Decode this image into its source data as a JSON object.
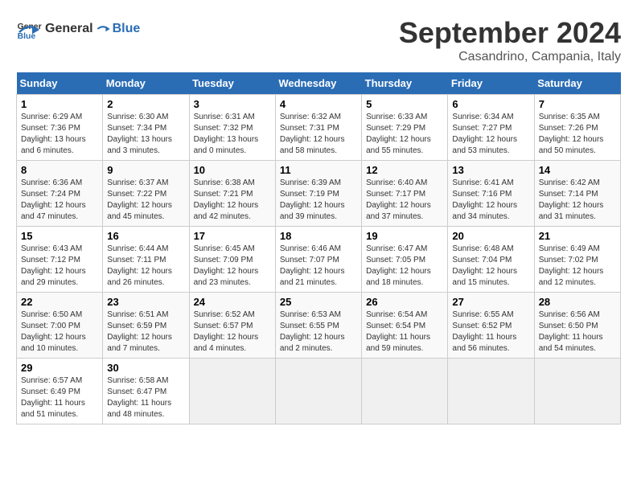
{
  "header": {
    "logo_text_general": "General",
    "logo_text_blue": "Blue",
    "month_title": "September 2024",
    "location": "Casandrino, Campania, Italy"
  },
  "calendar": {
    "days_of_week": [
      "Sunday",
      "Monday",
      "Tuesday",
      "Wednesday",
      "Thursday",
      "Friday",
      "Saturday"
    ],
    "weeks": [
      [
        {
          "day": "1",
          "sunrise": "6:29 AM",
          "sunset": "7:36 PM",
          "daylight": "13 hours and 6 minutes."
        },
        {
          "day": "2",
          "sunrise": "6:30 AM",
          "sunset": "7:34 PM",
          "daylight": "13 hours and 3 minutes."
        },
        {
          "day": "3",
          "sunrise": "6:31 AM",
          "sunset": "7:32 PM",
          "daylight": "13 hours and 0 minutes."
        },
        {
          "day": "4",
          "sunrise": "6:32 AM",
          "sunset": "7:31 PM",
          "daylight": "12 hours and 58 minutes."
        },
        {
          "day": "5",
          "sunrise": "6:33 AM",
          "sunset": "7:29 PM",
          "daylight": "12 hours and 55 minutes."
        },
        {
          "day": "6",
          "sunrise": "6:34 AM",
          "sunset": "7:27 PM",
          "daylight": "12 hours and 53 minutes."
        },
        {
          "day": "7",
          "sunrise": "6:35 AM",
          "sunset": "7:26 PM",
          "daylight": "12 hours and 50 minutes."
        }
      ],
      [
        {
          "day": "8",
          "sunrise": "6:36 AM",
          "sunset": "7:24 PM",
          "daylight": "12 hours and 47 minutes."
        },
        {
          "day": "9",
          "sunrise": "6:37 AM",
          "sunset": "7:22 PM",
          "daylight": "12 hours and 45 minutes."
        },
        {
          "day": "10",
          "sunrise": "6:38 AM",
          "sunset": "7:21 PM",
          "daylight": "12 hours and 42 minutes."
        },
        {
          "day": "11",
          "sunrise": "6:39 AM",
          "sunset": "7:19 PM",
          "daylight": "12 hours and 39 minutes."
        },
        {
          "day": "12",
          "sunrise": "6:40 AM",
          "sunset": "7:17 PM",
          "daylight": "12 hours and 37 minutes."
        },
        {
          "day": "13",
          "sunrise": "6:41 AM",
          "sunset": "7:16 PM",
          "daylight": "12 hours and 34 minutes."
        },
        {
          "day": "14",
          "sunrise": "6:42 AM",
          "sunset": "7:14 PM",
          "daylight": "12 hours and 31 minutes."
        }
      ],
      [
        {
          "day": "15",
          "sunrise": "6:43 AM",
          "sunset": "7:12 PM",
          "daylight": "12 hours and 29 minutes."
        },
        {
          "day": "16",
          "sunrise": "6:44 AM",
          "sunset": "7:11 PM",
          "daylight": "12 hours and 26 minutes."
        },
        {
          "day": "17",
          "sunrise": "6:45 AM",
          "sunset": "7:09 PM",
          "daylight": "12 hours and 23 minutes."
        },
        {
          "day": "18",
          "sunrise": "6:46 AM",
          "sunset": "7:07 PM",
          "daylight": "12 hours and 21 minutes."
        },
        {
          "day": "19",
          "sunrise": "6:47 AM",
          "sunset": "7:05 PM",
          "daylight": "12 hours and 18 minutes."
        },
        {
          "day": "20",
          "sunrise": "6:48 AM",
          "sunset": "7:04 PM",
          "daylight": "12 hours and 15 minutes."
        },
        {
          "day": "21",
          "sunrise": "6:49 AM",
          "sunset": "7:02 PM",
          "daylight": "12 hours and 12 minutes."
        }
      ],
      [
        {
          "day": "22",
          "sunrise": "6:50 AM",
          "sunset": "7:00 PM",
          "daylight": "12 hours and 10 minutes."
        },
        {
          "day": "23",
          "sunrise": "6:51 AM",
          "sunset": "6:59 PM",
          "daylight": "12 hours and 7 minutes."
        },
        {
          "day": "24",
          "sunrise": "6:52 AM",
          "sunset": "6:57 PM",
          "daylight": "12 hours and 4 minutes."
        },
        {
          "day": "25",
          "sunrise": "6:53 AM",
          "sunset": "6:55 PM",
          "daylight": "12 hours and 2 minutes."
        },
        {
          "day": "26",
          "sunrise": "6:54 AM",
          "sunset": "6:54 PM",
          "daylight": "11 hours and 59 minutes."
        },
        {
          "day": "27",
          "sunrise": "6:55 AM",
          "sunset": "6:52 PM",
          "daylight": "11 hours and 56 minutes."
        },
        {
          "day": "28",
          "sunrise": "6:56 AM",
          "sunset": "6:50 PM",
          "daylight": "11 hours and 54 minutes."
        }
      ],
      [
        {
          "day": "29",
          "sunrise": "6:57 AM",
          "sunset": "6:49 PM",
          "daylight": "11 hours and 51 minutes."
        },
        {
          "day": "30",
          "sunrise": "6:58 AM",
          "sunset": "6:47 PM",
          "daylight": "11 hours and 48 minutes."
        },
        null,
        null,
        null,
        null,
        null
      ]
    ]
  }
}
